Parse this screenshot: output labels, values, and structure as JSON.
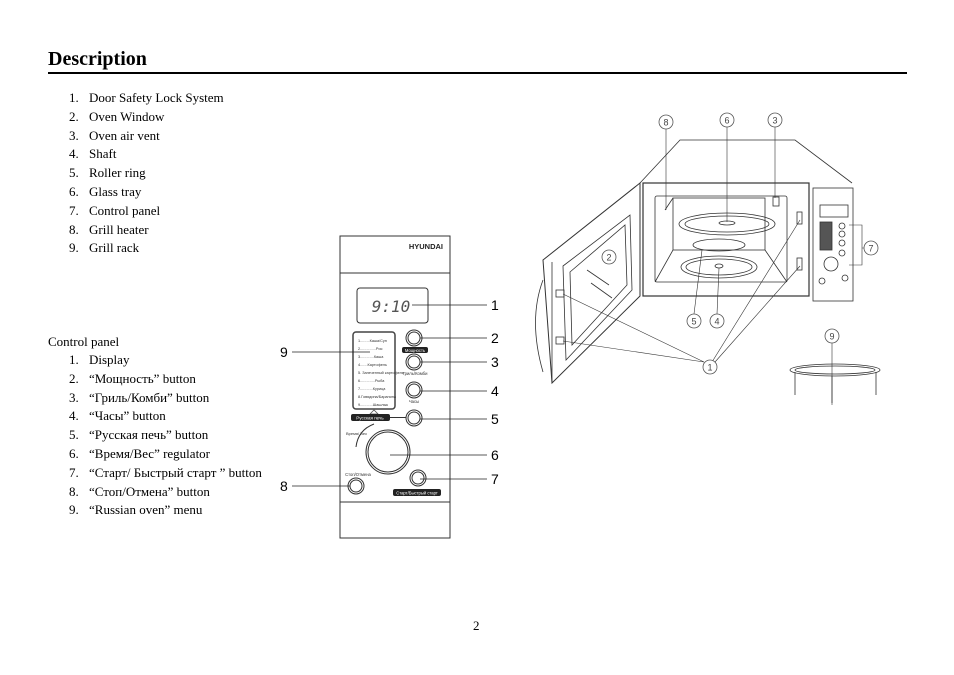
{
  "page": {
    "title": "Description",
    "page_number": "2"
  },
  "parts_list": [
    {
      "num": "1.",
      "label": "Door Safety Lock System"
    },
    {
      "num": "2.",
      "label": "Oven Window"
    },
    {
      "num": "3.",
      "label": "Oven air vent"
    },
    {
      "num": "4.",
      "label": "Shaft"
    },
    {
      "num": "5.",
      "label": "Roller ring"
    },
    {
      "num": "6.",
      "label": "Glass tray"
    },
    {
      "num": "7.",
      "label": "Control panel"
    },
    {
      "num": "8.",
      "label": "Grill heater"
    },
    {
      "num": "9.",
      "label": "Grill rack"
    }
  ],
  "control_panel": {
    "heading": "Control panel",
    "items": [
      {
        "num": "1.",
        "label": "Display"
      },
      {
        "num": "2.",
        "label": "“Мощность” button"
      },
      {
        "num": "3.",
        "label": "“Гриль/Комби” button"
      },
      {
        "num": "4.",
        "label": "“Часы” button"
      },
      {
        "num": "5.",
        "label": "“Русская печь” button"
      },
      {
        "num": "6.",
        "label": "“Время/Вес” regulator"
      },
      {
        "num": "7.",
        "label": "“Старт/ Быстрый старт ” button"
      },
      {
        "num": "8.",
        "label": "“Стоп/Отмена” button"
      },
      {
        "num": "9.",
        "label": "“Russian oven” menu"
      }
    ]
  },
  "panel_figure": {
    "brand": "HYUNDAI",
    "display_time": "9:10",
    "menu_items": [
      "1.........Каша/Суп",
      "2...............Рис",
      "3.............Каша",
      "4.......Картофель",
      "5. Запеченный картофель",
      "6..............Рыба",
      "7............Курица",
      "8.Говядина/Баранина",
      "9............Шашлык"
    ],
    "labels": {
      "power": "Мощность",
      "grill_combi": "Гриль/Комби",
      "clock": "Часы",
      "russian_oven": "Русская печь",
      "time_weight": "Время/ Вес",
      "stop_cancel": "Стоп/Отмена",
      "start": "Старт/Быстрый старт"
    },
    "callouts": [
      "1",
      "2",
      "3",
      "4",
      "5",
      "6",
      "7",
      "8",
      "9"
    ]
  },
  "oven_figure": {
    "callouts": {
      "door_lock": "1",
      "window": "2",
      "vent": "3",
      "shaft": "4",
      "roller": "5",
      "tray": "6",
      "control": "7",
      "grill_heater": "8",
      "grill_rack": "9"
    }
  }
}
